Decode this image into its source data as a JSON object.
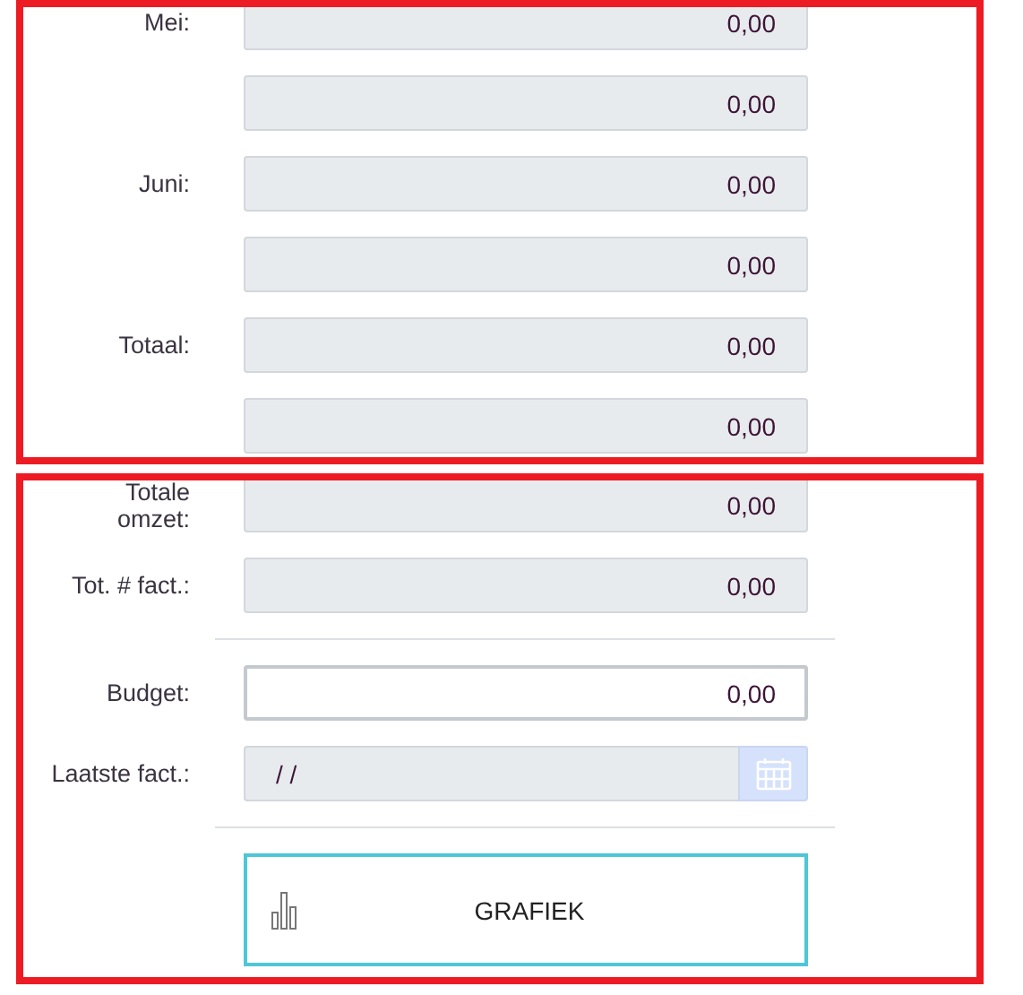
{
  "sections": [
    {
      "rows": [
        {
          "kind": "amount",
          "label": "Mei:",
          "value": "0,00",
          "disabled": true
        },
        {
          "kind": "amount",
          "value": "0,00",
          "disabled": true
        },
        {
          "kind": "amount",
          "label": "Juni:",
          "value": "0,00",
          "disabled": true
        },
        {
          "kind": "amount",
          "value": "0,00",
          "disabled": true
        },
        {
          "kind": "amount",
          "label": "Totaal:",
          "value": "0,00",
          "disabled": true
        },
        {
          "kind": "amount",
          "value": "0,00",
          "disabled": true
        }
      ]
    },
    {
      "rows": [
        {
          "kind": "amount",
          "label": "Totale omzet:",
          "value": "0,00",
          "disabled": true
        },
        {
          "kind": "amount",
          "label": "Tot. # fact.:",
          "value": "0,00",
          "disabled": true
        },
        {
          "kind": "divider"
        },
        {
          "kind": "amount",
          "label": "Budget:",
          "value": "0,00",
          "disabled": false
        },
        {
          "kind": "date",
          "label": "Laatste fact.:",
          "value": "/ /",
          "disabled": true
        },
        {
          "kind": "divider"
        },
        {
          "kind": "button",
          "label": "GRAFIEK"
        }
      ]
    }
  ]
}
